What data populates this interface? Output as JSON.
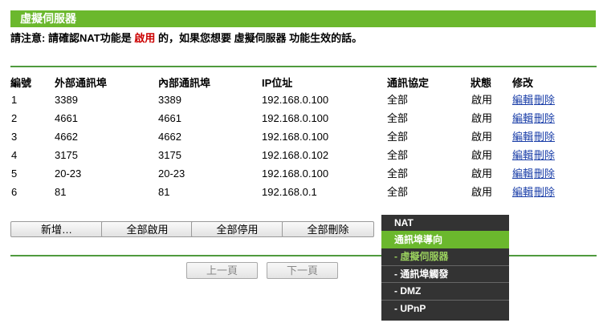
{
  "header": {
    "title": "虛擬伺服器"
  },
  "notice": {
    "prefix": "請注意:  請確認NAT功能是 ",
    "highlight": "啟用",
    "suffix": " 的，如果您想要 虛擬伺服器 功能生效的話。"
  },
  "table": {
    "columns": [
      "編號",
      "外部通訊埠",
      "內部通訊埠",
      "IP位址",
      "通訊協定",
      "狀態",
      "修改"
    ],
    "rows": [
      {
        "id": "1",
        "ext": "3389",
        "int": "3389",
        "ip": "192.168.0.100",
        "proto": "全部",
        "status": "啟用",
        "edit": "編輯",
        "delete": "刪除"
      },
      {
        "id": "2",
        "ext": "4661",
        "int": "4661",
        "ip": "192.168.0.100",
        "proto": "全部",
        "status": "啟用",
        "edit": "編輯",
        "delete": "刪除"
      },
      {
        "id": "3",
        "ext": "4662",
        "int": "4662",
        "ip": "192.168.0.100",
        "proto": "全部",
        "status": "啟用",
        "edit": "編輯",
        "delete": "刪除"
      },
      {
        "id": "4",
        "ext": "3175",
        "int": "3175",
        "ip": "192.168.0.102",
        "proto": "全部",
        "status": "啟用",
        "edit": "編輯",
        "delete": "刪除"
      },
      {
        "id": "5",
        "ext": "20-23",
        "int": "20-23",
        "ip": "192.168.0.100",
        "proto": "全部",
        "status": "啟用",
        "edit": "編輯",
        "delete": "刪除"
      },
      {
        "id": "6",
        "ext": "81",
        "int": "81",
        "ip": "192.168.0.1",
        "proto": "全部",
        "status": "啟用",
        "edit": "編輯",
        "delete": "刪除"
      }
    ]
  },
  "buttons": {
    "add": "新增…",
    "enable_all": "全部啟用",
    "disable_all": "全部停用",
    "delete_all": "全部刪除"
  },
  "pagination": {
    "prev": "上一頁",
    "next": "下一頁"
  },
  "menu": {
    "items": [
      {
        "label": "NAT"
      },
      {
        "label": "通訊埠導向"
      },
      {
        "label": "- 虛擬伺服器"
      },
      {
        "label": "- 通訊埠觸發"
      },
      {
        "label": "- DMZ"
      },
      {
        "label": "- UPnP"
      }
    ]
  },
  "colors": {
    "accent": "#6bb82d",
    "menu_bg": "#333333",
    "link": "#1a3ea8",
    "highlight": "#cc0000"
  }
}
